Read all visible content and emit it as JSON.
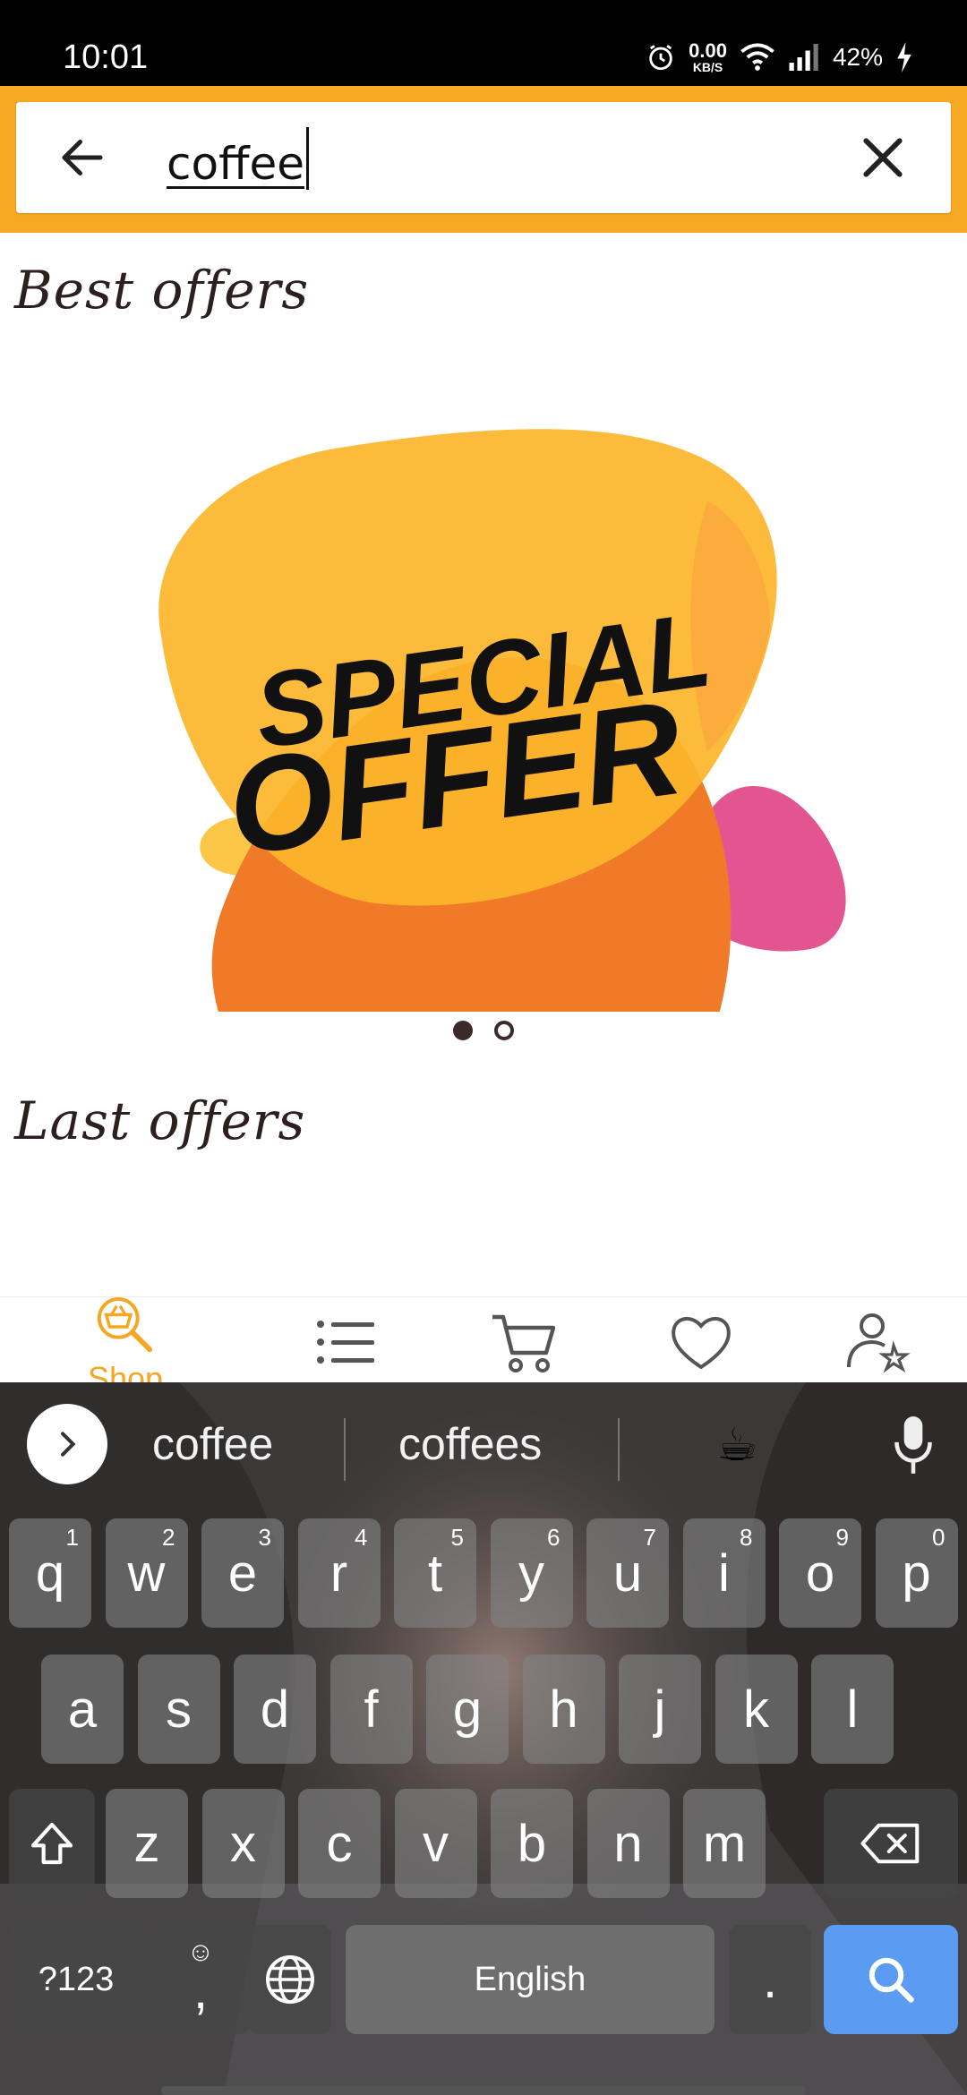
{
  "status_bar": {
    "time": "10:01",
    "net_speed_value": "0.00",
    "net_speed_unit": "KB/S",
    "battery": "42%"
  },
  "search": {
    "query": "coffee",
    "back_icon": "arrow-left-icon",
    "clear_icon": "close-icon",
    "bar_color": "#F8A825"
  },
  "sections": {
    "best_offers_title": "Best offers",
    "last_offers_title": "Last offers"
  },
  "banner": {
    "text_line1": "SPECIAL",
    "text_line2": "OFFER",
    "active_slide": 1,
    "slide_count": 2
  },
  "bottom_nav": {
    "items": [
      {
        "icon": "shop-basket-search-icon",
        "label": "Shop"
      },
      {
        "icon": "list-icon",
        "label": ""
      },
      {
        "icon": "cart-icon",
        "label": ""
      },
      {
        "icon": "heart-icon",
        "label": ""
      },
      {
        "icon": "user-star-icon",
        "label": ""
      }
    ],
    "active_color": "#F5A623"
  },
  "keyboard": {
    "suggestions": [
      "coffee",
      "coffees"
    ],
    "suggestion_emoji": "☕",
    "row1": [
      {
        "k": "q",
        "h": "1"
      },
      {
        "k": "w",
        "h": "2"
      },
      {
        "k": "e",
        "h": "3"
      },
      {
        "k": "r",
        "h": "4"
      },
      {
        "k": "t",
        "h": "5"
      },
      {
        "k": "y",
        "h": "6"
      },
      {
        "k": "u",
        "h": "7"
      },
      {
        "k": "i",
        "h": "8"
      },
      {
        "k": "o",
        "h": "9"
      },
      {
        "k": "p",
        "h": "0"
      }
    ],
    "row2": [
      "a",
      "s",
      "d",
      "f",
      "g",
      "h",
      "j",
      "k",
      "l"
    ],
    "row3": [
      "z",
      "x",
      "c",
      "v",
      "b",
      "n",
      "m"
    ],
    "symbols_label": "?123",
    "comma_label": ",",
    "space_label": "English",
    "period_label": ".",
    "action_color": "#5B9BF2"
  }
}
